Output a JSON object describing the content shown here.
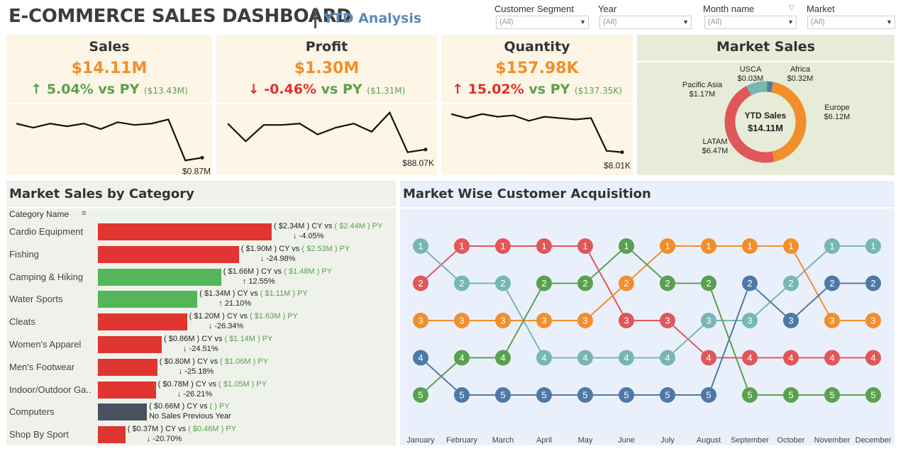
{
  "header": {
    "title": "E-COMMERCE SALES DASHBOARD",
    "subtitle": "YTD Analysis"
  },
  "filters": [
    {
      "label": "Customer Segment",
      "value": "(All)"
    },
    {
      "label": "Year",
      "value": "(All)"
    },
    {
      "label": "Month name",
      "value": "(All)"
    },
    {
      "label": "Market",
      "value": "(All)"
    }
  ],
  "kpis": [
    {
      "title": "Sales",
      "value": "$14.11M",
      "direction": "up",
      "delta": "5.04%",
      "vs": "vs PY",
      "py": "($13.43M)",
      "last_label": "$0.87M",
      "sparkline": [
        0.9,
        0.87,
        0.9,
        0.88,
        0.9,
        0.86,
        0.91,
        0.89,
        0.9,
        0.93,
        0.63,
        0.65
      ]
    },
    {
      "title": "Profit",
      "value": "$1.30M",
      "direction": "down",
      "delta": "-0.46%",
      "vs": "vs PY",
      "py": "($1.31M)",
      "last_label": "$88.07K",
      "sparkline": [
        0.9,
        0.77,
        0.89,
        0.89,
        0.9,
        0.82,
        0.87,
        0.9,
        0.84,
        0.98,
        0.69,
        0.71
      ]
    },
    {
      "title": "Quantity",
      "value": "$157.98K",
      "direction": "up",
      "delta": "15.02%",
      "vs": "vs PY",
      "py": "($137.35K)",
      "last_label": "$8.01K",
      "sparkline": [
        0.97,
        0.94,
        0.97,
        0.95,
        0.96,
        0.92,
        0.95,
        0.94,
        0.93,
        0.94,
        0.7,
        0.69
      ]
    }
  ],
  "market_sales": {
    "title": "Market Sales",
    "center_label": "YTD Sales",
    "center_value": "$14.11M",
    "slices": [
      {
        "name": "Africa",
        "value": "$0.32M",
        "amount": 0.32,
        "color": "#4e79a7"
      },
      {
        "name": "Europe",
        "value": "$6.12M",
        "amount": 6.12,
        "color": "#f28e2b"
      },
      {
        "name": "LATAM",
        "value": "$6.47M",
        "amount": 6.47,
        "color": "#e15759"
      },
      {
        "name": "Pacific Asia",
        "value": "$1.17M",
        "amount": 1.17,
        "color": "#76b7b2"
      },
      {
        "name": "USCA",
        "value": "$0.03M",
        "amount": 0.03,
        "color": "#59a14f"
      }
    ]
  },
  "category": {
    "title": "Market Sales by Category",
    "column_header": "Category Name",
    "vs_text": "CY vs",
    "py_suffix": "PY",
    "rows": [
      {
        "name": "Cardio Equipment",
        "cy": "$2.34M",
        "py": "$2.44M",
        "change": "-4.05%",
        "arrow": "↓",
        "amount": 2.34,
        "color": "#e03531"
      },
      {
        "name": "Fishing",
        "cy": "$1.90M",
        "py": "$2.53M",
        "change": "-24.98%",
        "arrow": "↓",
        "amount": 1.9,
        "color": "#e03531"
      },
      {
        "name": "Camping & Hiking",
        "cy": "$1.66M",
        "py": "$1.48M",
        "change": "12.55%",
        "arrow": "↑",
        "amount": 1.66,
        "color": "#54b55b"
      },
      {
        "name": "Water Sports",
        "cy": "$1.34M",
        "py": "$1.11M",
        "change": "21.10%",
        "arrow": "↑",
        "amount": 1.34,
        "color": "#54b55b"
      },
      {
        "name": "Cleats",
        "cy": "$1.20M",
        "py": "$1.63M",
        "change": "-26.34%",
        "arrow": "↓",
        "amount": 1.2,
        "color": "#e03531"
      },
      {
        "name": "Women's Apparel",
        "cy": "$0.86M",
        "py": "$1.14M",
        "change": "-24.51%",
        "arrow": "↓",
        "amount": 0.86,
        "color": "#e03531"
      },
      {
        "name": "Men's Footwear",
        "cy": "$0.80M",
        "py": "$1.06M",
        "change": "-25.18%",
        "arrow": "↓",
        "amount": 0.8,
        "color": "#e03531"
      },
      {
        "name": "Indoor/Outdoor Ga..",
        "cy": "$0.78M",
        "py": "$1.05M",
        "change": "-26.21%",
        "arrow": "↓",
        "amount": 0.78,
        "color": "#e03531"
      },
      {
        "name": "Computers",
        "cy": "$0.66M",
        "py": "",
        "change": "No Sales Previous Year",
        "arrow": "",
        "amount": 0.66,
        "color": "#4a5262"
      },
      {
        "name": "Shop By Sport",
        "cy": "$0.37M",
        "py": "$0.46M",
        "change": "-20.70%",
        "arrow": "↓",
        "amount": 0.37,
        "color": "#e03531"
      }
    ]
  },
  "chart_data": {
    "type": "line",
    "title": "Market Wise Customer Acquisition",
    "categories": [
      "January",
      "February",
      "March",
      "April",
      "May",
      "June",
      "July",
      "August",
      "September",
      "October",
      "November",
      "December"
    ],
    "ylim": [
      5,
      1
    ],
    "series": [
      {
        "color": "#e15759",
        "values": [
          2,
          1,
          1,
          1,
          1,
          3,
          3,
          4,
          4,
          4,
          4,
          4
        ]
      },
      {
        "color": "#76b7b2",
        "values": [
          1,
          2,
          2,
          4,
          4,
          4,
          4,
          3,
          3,
          2,
          1,
          1
        ]
      },
      {
        "color": "#f28e2b",
        "values": [
          3,
          3,
          3,
          3,
          3,
          2,
          1,
          1,
          1,
          1,
          3,
          3
        ]
      },
      {
        "color": "#4e79a7",
        "values": [
          4,
          5,
          5,
          5,
          5,
          5,
          5,
          5,
          2,
          3,
          2,
          2
        ]
      },
      {
        "color": "#59a14f",
        "values": [
          5,
          4,
          4,
          2,
          2,
          1,
          2,
          2,
          5,
          5,
          5,
          5
        ]
      }
    ]
  }
}
